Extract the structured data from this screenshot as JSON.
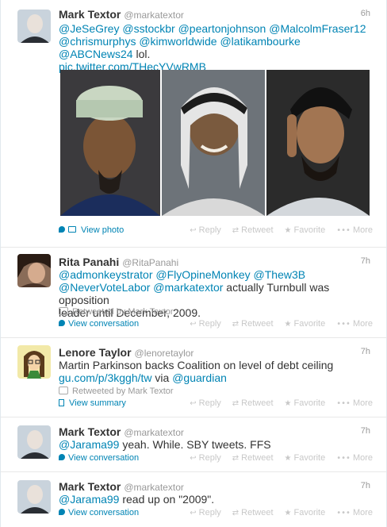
{
  "actions": {
    "reply": "Reply",
    "retweet": "Retweet",
    "favorite": "Favorite",
    "more": "More"
  },
  "tweets": [
    {
      "fullname": "Mark Textor",
      "username": "@markatextor",
      "time": "6h",
      "line1": [
        "@JeSeGrey",
        "@sstockbr",
        "@peartonjohnson",
        "@MalcolmFraser12"
      ],
      "line2": [
        "@chrismurphys",
        "@kimworldwide",
        "@latikambourke",
        "@ABCNews24"
      ],
      "line2_tail": "lol.",
      "link": "pic.twitter.com/THecYVwRMB",
      "expand": "View photo"
    },
    {
      "fullname": "Rita Panahi",
      "username": "@RitaPanahi",
      "time": "7h",
      "line1": [
        "@admonkeystrator",
        "@FlyOpineMonkey",
        "@Thew3B"
      ],
      "line2": [
        "@NeverVoteLabor",
        "@markatextor"
      ],
      "line2_tail": "actually Turnbull was opposition",
      "line3": "leader until December, 2009.",
      "context": "Retweeted by Mark Textor",
      "expand": "View conversation"
    },
    {
      "fullname": "Lenore Taylor",
      "username": "@lenoretaylor",
      "time": "7h",
      "line1_text": "Martin Parkinson backs Coalition on level of debt ceiling",
      "link": "gu.com/p/3kggh/tw",
      "via": "via",
      "via_mention": "@guardian",
      "context": "Retweeted by Mark Textor",
      "expand": "View summary"
    },
    {
      "fullname": "Mark Textor",
      "username": "@markatextor",
      "time": "7h",
      "mention": "@Jarama99",
      "text": "yeah. While. SBY tweets. FFS",
      "expand": "View conversation"
    },
    {
      "fullname": "Mark Textor",
      "username": "@markatextor",
      "time": "7h",
      "mention": "@Jarama99",
      "text": "read up on \"2009\".",
      "expand": "View conversation"
    }
  ]
}
